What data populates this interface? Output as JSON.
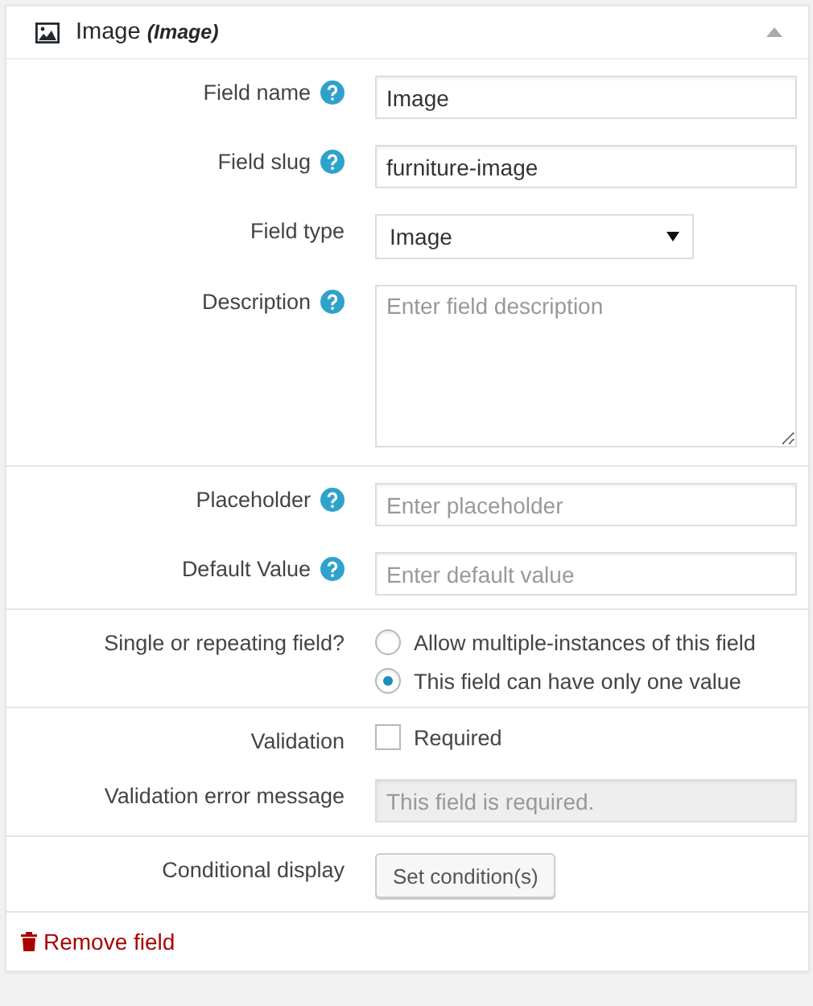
{
  "header": {
    "title": "Image",
    "subtitle": "(Image)",
    "expanded": true
  },
  "sections": [
    {
      "rows": [
        {
          "kind": "text",
          "label": "Field name",
          "help": true,
          "value": "Image"
        },
        {
          "kind": "text",
          "label": "Field slug",
          "help": true,
          "value": "furniture-image"
        },
        {
          "kind": "select",
          "label": "Field type",
          "help": false,
          "value": "Image"
        },
        {
          "kind": "textarea",
          "label": "Description",
          "help": true,
          "placeholder": "Enter field description"
        }
      ]
    },
    {
      "rows": [
        {
          "kind": "text",
          "label": "Placeholder",
          "help": true,
          "placeholder": "Enter placeholder"
        },
        {
          "kind": "text",
          "label": "Default Value",
          "help": true,
          "placeholder": "Enter default value"
        }
      ]
    },
    {
      "rows": [
        {
          "kind": "radio",
          "label": "Single or repeating field?",
          "help": false,
          "options": [
            {
              "label": "Allow multiple-instances of this field",
              "selected": false
            },
            {
              "label": "This field can have only one value",
              "selected": true
            }
          ]
        }
      ]
    },
    {
      "rows": [
        {
          "kind": "checkbox",
          "label": "Validation",
          "help": false,
          "option": "Required",
          "checked": false
        },
        {
          "kind": "text",
          "label": "Validation error message",
          "help": false,
          "placeholder": "This field is required.",
          "disabled": true
        }
      ]
    },
    {
      "rows": [
        {
          "kind": "button",
          "label": "Conditional display",
          "help": false,
          "button": "Set condition(s)"
        }
      ]
    }
  ],
  "footer": {
    "link": "Remove field"
  }
}
